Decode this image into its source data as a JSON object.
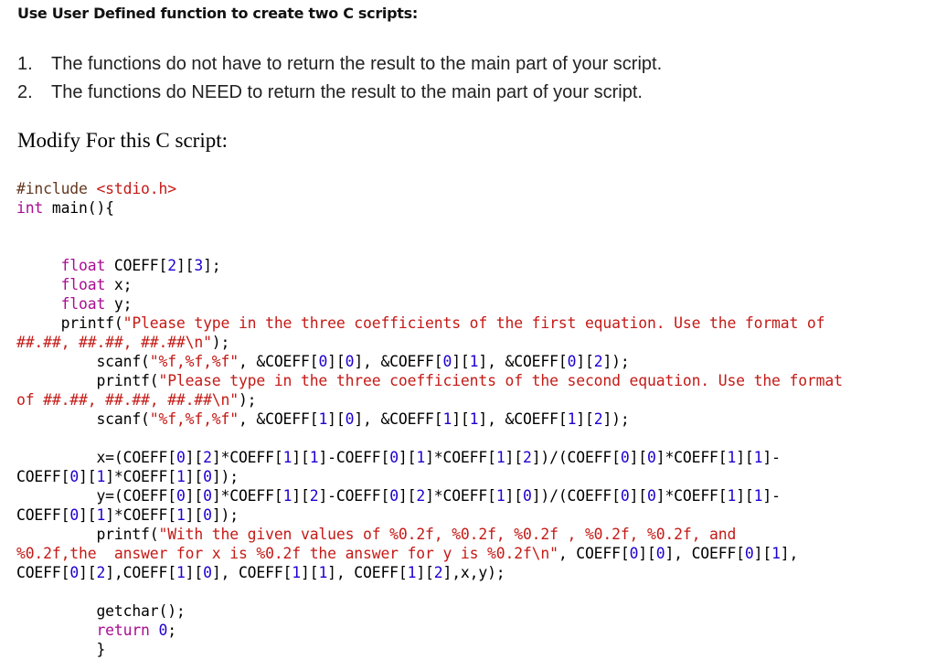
{
  "heading": "Use User Defined function to create two C scripts:",
  "list": [
    {
      "num": "1.",
      "text": "The functions do not have to return the result to the main part of your script."
    },
    {
      "num": "2.",
      "text": "The functions do NEED to return the result to the main part of your script."
    }
  ],
  "subheading": "Modify For this C script:",
  "code": {
    "colors": {
      "keyword": "#aa0d91",
      "preprocessor": "#643820",
      "string": "#c41a16",
      "number": "#1c00cf",
      "text": "#000000"
    },
    "lines": [
      [
        {
          "t": "pp",
          "s": "#include "
        },
        {
          "t": "str",
          "s": "<stdio.h>"
        }
      ],
      [
        {
          "t": "kw",
          "s": "int"
        },
        {
          "t": "",
          "s": " main(){"
        }
      ],
      [],
      [],
      [
        {
          "t": "",
          "s": "     "
        },
        {
          "t": "kw",
          "s": "float"
        },
        {
          "t": "",
          "s": " COEFF["
        },
        {
          "t": "num",
          "s": "2"
        },
        {
          "t": "",
          "s": "]["
        },
        {
          "t": "num",
          "s": "3"
        },
        {
          "t": "",
          "s": "];"
        }
      ],
      [
        {
          "t": "",
          "s": "     "
        },
        {
          "t": "kw",
          "s": "float"
        },
        {
          "t": "",
          "s": " x;"
        }
      ],
      [
        {
          "t": "",
          "s": "     "
        },
        {
          "t": "kw",
          "s": "float"
        },
        {
          "t": "",
          "s": " y;"
        }
      ],
      [
        {
          "t": "",
          "s": "     printf("
        },
        {
          "t": "str",
          "s": "\"Please type in the three coefficients of the first equation. Use the format of"
        }
      ],
      [
        {
          "t": "str",
          "s": "##.##, ##.##, ##.##\\n\""
        },
        {
          "t": "",
          "s": ");"
        }
      ],
      [
        {
          "t": "",
          "s": "         scanf("
        },
        {
          "t": "str",
          "s": "\"%f,%f,%f\""
        },
        {
          "t": "",
          "s": ", &COEFF["
        },
        {
          "t": "num",
          "s": "0"
        },
        {
          "t": "",
          "s": "]["
        },
        {
          "t": "num",
          "s": "0"
        },
        {
          "t": "",
          "s": "], &COEFF["
        },
        {
          "t": "num",
          "s": "0"
        },
        {
          "t": "",
          "s": "]["
        },
        {
          "t": "num",
          "s": "1"
        },
        {
          "t": "",
          "s": "], &COEFF["
        },
        {
          "t": "num",
          "s": "0"
        },
        {
          "t": "",
          "s": "]["
        },
        {
          "t": "num",
          "s": "2"
        },
        {
          "t": "",
          "s": "]);"
        }
      ],
      [
        {
          "t": "",
          "s": "         printf("
        },
        {
          "t": "str",
          "s": "\"Please type in the three coefficients of the second equation. Use the format"
        }
      ],
      [
        {
          "t": "str",
          "s": "of ##.##, ##.##, ##.##\\n\""
        },
        {
          "t": "",
          "s": ");"
        }
      ],
      [
        {
          "t": "",
          "s": "         scanf("
        },
        {
          "t": "str",
          "s": "\"%f,%f,%f\""
        },
        {
          "t": "",
          "s": ", &COEFF["
        },
        {
          "t": "num",
          "s": "1"
        },
        {
          "t": "",
          "s": "]["
        },
        {
          "t": "num",
          "s": "0"
        },
        {
          "t": "",
          "s": "], &COEFF["
        },
        {
          "t": "num",
          "s": "1"
        },
        {
          "t": "",
          "s": "]["
        },
        {
          "t": "num",
          "s": "1"
        },
        {
          "t": "",
          "s": "], &COEFF["
        },
        {
          "t": "num",
          "s": "1"
        },
        {
          "t": "",
          "s": "]["
        },
        {
          "t": "num",
          "s": "2"
        },
        {
          "t": "",
          "s": "]);"
        }
      ],
      [],
      [
        {
          "t": "",
          "s": "         x=(COEFF["
        },
        {
          "t": "num",
          "s": "0"
        },
        {
          "t": "",
          "s": "]["
        },
        {
          "t": "num",
          "s": "2"
        },
        {
          "t": "",
          "s": "]*COEFF["
        },
        {
          "t": "num",
          "s": "1"
        },
        {
          "t": "",
          "s": "]["
        },
        {
          "t": "num",
          "s": "1"
        },
        {
          "t": "",
          "s": "]-COEFF["
        },
        {
          "t": "num",
          "s": "0"
        },
        {
          "t": "",
          "s": "]["
        },
        {
          "t": "num",
          "s": "1"
        },
        {
          "t": "",
          "s": "]*COEFF["
        },
        {
          "t": "num",
          "s": "1"
        },
        {
          "t": "",
          "s": "]["
        },
        {
          "t": "num",
          "s": "2"
        },
        {
          "t": "",
          "s": "])/(COEFF["
        },
        {
          "t": "num",
          "s": "0"
        },
        {
          "t": "",
          "s": "]["
        },
        {
          "t": "num",
          "s": "0"
        },
        {
          "t": "",
          "s": "]*COEFF["
        },
        {
          "t": "num",
          "s": "1"
        },
        {
          "t": "",
          "s": "]["
        },
        {
          "t": "num",
          "s": "1"
        },
        {
          "t": "",
          "s": "]-"
        }
      ],
      [
        {
          "t": "",
          "s": "COEFF["
        },
        {
          "t": "num",
          "s": "0"
        },
        {
          "t": "",
          "s": "]["
        },
        {
          "t": "num",
          "s": "1"
        },
        {
          "t": "",
          "s": "]*COEFF["
        },
        {
          "t": "num",
          "s": "1"
        },
        {
          "t": "",
          "s": "]["
        },
        {
          "t": "num",
          "s": "0"
        },
        {
          "t": "",
          "s": "]);"
        }
      ],
      [
        {
          "t": "",
          "s": "         y=(COEFF["
        },
        {
          "t": "num",
          "s": "0"
        },
        {
          "t": "",
          "s": "]["
        },
        {
          "t": "num",
          "s": "0"
        },
        {
          "t": "",
          "s": "]*COEFF["
        },
        {
          "t": "num",
          "s": "1"
        },
        {
          "t": "",
          "s": "]["
        },
        {
          "t": "num",
          "s": "2"
        },
        {
          "t": "",
          "s": "]-COEFF["
        },
        {
          "t": "num",
          "s": "0"
        },
        {
          "t": "",
          "s": "]["
        },
        {
          "t": "num",
          "s": "2"
        },
        {
          "t": "",
          "s": "]*COEFF["
        },
        {
          "t": "num",
          "s": "1"
        },
        {
          "t": "",
          "s": "]["
        },
        {
          "t": "num",
          "s": "0"
        },
        {
          "t": "",
          "s": "])/(COEFF["
        },
        {
          "t": "num",
          "s": "0"
        },
        {
          "t": "",
          "s": "]["
        },
        {
          "t": "num",
          "s": "0"
        },
        {
          "t": "",
          "s": "]*COEFF["
        },
        {
          "t": "num",
          "s": "1"
        },
        {
          "t": "",
          "s": "]["
        },
        {
          "t": "num",
          "s": "1"
        },
        {
          "t": "",
          "s": "]-"
        }
      ],
      [
        {
          "t": "",
          "s": "COEFF["
        },
        {
          "t": "num",
          "s": "0"
        },
        {
          "t": "",
          "s": "]["
        },
        {
          "t": "num",
          "s": "1"
        },
        {
          "t": "",
          "s": "]*COEFF["
        },
        {
          "t": "num",
          "s": "1"
        },
        {
          "t": "",
          "s": "]["
        },
        {
          "t": "num",
          "s": "0"
        },
        {
          "t": "",
          "s": "]);"
        }
      ],
      [
        {
          "t": "",
          "s": "         printf("
        },
        {
          "t": "str",
          "s": "\"With the given values of %0.2f, %0.2f, %0.2f , %0.2f, %0.2f, and"
        }
      ],
      [
        {
          "t": "str",
          "s": "%0.2f,the  answer for x is %0.2f the answer for y is %0.2f\\n\""
        },
        {
          "t": "",
          "s": ", COEFF["
        },
        {
          "t": "num",
          "s": "0"
        },
        {
          "t": "",
          "s": "]["
        },
        {
          "t": "num",
          "s": "0"
        },
        {
          "t": "",
          "s": "], COEFF["
        },
        {
          "t": "num",
          "s": "0"
        },
        {
          "t": "",
          "s": "]["
        },
        {
          "t": "num",
          "s": "1"
        },
        {
          "t": "",
          "s": "],"
        }
      ],
      [
        {
          "t": "",
          "s": "COEFF["
        },
        {
          "t": "num",
          "s": "0"
        },
        {
          "t": "",
          "s": "]["
        },
        {
          "t": "num",
          "s": "2"
        },
        {
          "t": "",
          "s": "],COEFF["
        },
        {
          "t": "num",
          "s": "1"
        },
        {
          "t": "",
          "s": "]["
        },
        {
          "t": "num",
          "s": "0"
        },
        {
          "t": "",
          "s": "], COEFF["
        },
        {
          "t": "num",
          "s": "1"
        },
        {
          "t": "",
          "s": "]["
        },
        {
          "t": "num",
          "s": "1"
        },
        {
          "t": "",
          "s": "], COEFF["
        },
        {
          "t": "num",
          "s": "1"
        },
        {
          "t": "",
          "s": "]["
        },
        {
          "t": "num",
          "s": "2"
        },
        {
          "t": "",
          "s": "],x,y);"
        }
      ],
      [],
      [
        {
          "t": "",
          "s": "         getchar();"
        }
      ],
      [
        {
          "t": "",
          "s": "         "
        },
        {
          "t": "kw",
          "s": "return"
        },
        {
          "t": "",
          "s": " "
        },
        {
          "t": "num",
          "s": "0"
        },
        {
          "t": "",
          "s": ";"
        }
      ],
      [
        {
          "t": "",
          "s": "         }"
        }
      ]
    ]
  }
}
